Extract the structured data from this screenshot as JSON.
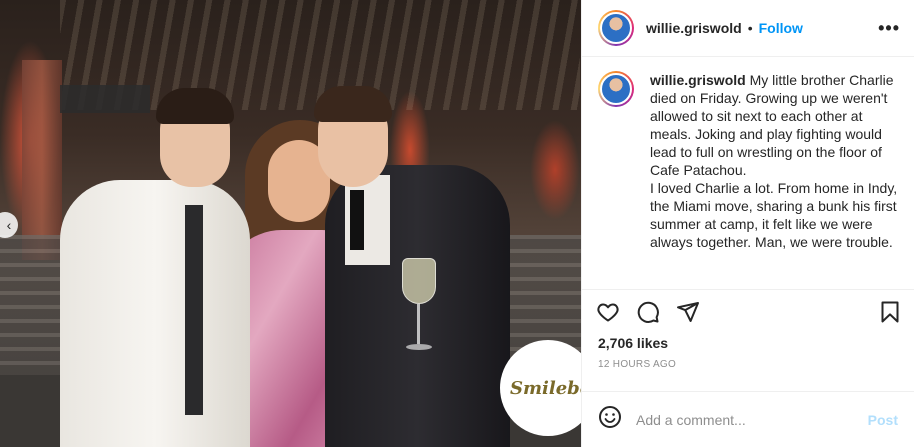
{
  "photo": {
    "watermark": "Smilebooth",
    "prev_icon": "chevron-left-icon"
  },
  "header": {
    "username": "willie.griswold",
    "separator": "•",
    "follow_label": "Follow",
    "more_label": "•••"
  },
  "caption": {
    "username": "willie.griswold",
    "paragraphs": [
      "My little brother Charlie died on Friday. Growing up we weren't allowed to sit next to each other at meals. Joking and play fighting would lead to full on wrestling on the floor of Cafe Patachou.",
      "I loved Charlie a lot. From home in Indy, the Miami move, sharing a bunk his first summer at camp, it felt like we were always together. Man, we were trouble."
    ]
  },
  "actions": {
    "icons": [
      "heart-icon",
      "comment-icon",
      "share-icon",
      "bookmark-icon"
    ]
  },
  "likes": "2,706 likes",
  "timestamp": "12 HOURS AGO",
  "comment": {
    "placeholder": "Add a comment...",
    "post_label": "Post",
    "emoji_icon": "emoji-icon"
  },
  "colors": {
    "link": "#0095f6",
    "post_disabled": "#b2dffc",
    "text": "#262626",
    "muted": "#8e8e8e"
  }
}
